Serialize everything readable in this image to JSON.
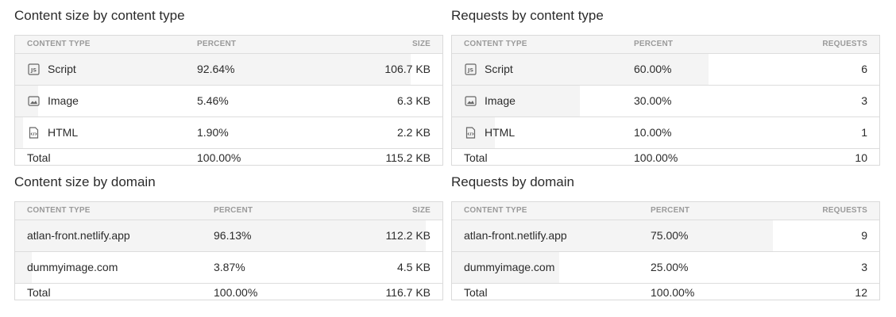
{
  "panels": {
    "size_type": {
      "title": "Content size by content type",
      "columns": [
        "CONTENT TYPE",
        "PERCENT",
        "SIZE"
      ],
      "rows": [
        {
          "icon": "js-file-icon",
          "name": "Script",
          "percent": "92.64%",
          "value": "106.7 KB",
          "share": 0.9264
        },
        {
          "icon": "image-file-icon",
          "name": "Image",
          "percent": "5.46%",
          "value": "6.3 KB",
          "share": 0.0546
        },
        {
          "icon": "html-file-icon",
          "name": "HTML",
          "percent": "1.90%",
          "value": "2.2 KB",
          "share": 0.019
        }
      ],
      "total": {
        "label": "Total",
        "percent": "100.00%",
        "value": "115.2 KB"
      }
    },
    "requests_type": {
      "title": "Requests by content type",
      "columns": [
        "CONTENT TYPE",
        "PERCENT",
        "REQUESTS"
      ],
      "rows": [
        {
          "icon": "js-file-icon",
          "name": "Script",
          "percent": "60.00%",
          "value": "6",
          "share": 0.6
        },
        {
          "icon": "image-file-icon",
          "name": "Image",
          "percent": "30.00%",
          "value": "3",
          "share": 0.3
        },
        {
          "icon": "html-file-icon",
          "name": "HTML",
          "percent": "10.00%",
          "value": "1",
          "share": 0.1
        }
      ],
      "total": {
        "label": "Total",
        "percent": "100.00%",
        "value": "10"
      }
    },
    "size_domain": {
      "title": "Content size by domain",
      "columns": [
        "CONTENT TYPE",
        "PERCENT",
        "SIZE"
      ],
      "rows": [
        {
          "name": "atlan-front.netlify.app",
          "percent": "96.13%",
          "value": "112.2 KB",
          "share": 0.9613
        },
        {
          "name": "dummyimage.com",
          "percent": "3.87%",
          "value": "4.5 KB",
          "share": 0.0387
        }
      ],
      "total": {
        "label": "Total",
        "percent": "100.00%",
        "value": "116.7 KB"
      }
    },
    "requests_domain": {
      "title": "Requests by domain",
      "columns": [
        "CONTENT TYPE",
        "PERCENT",
        "REQUESTS"
      ],
      "rows": [
        {
          "name": "atlan-front.netlify.app",
          "percent": "75.00%",
          "value": "9",
          "share": 0.75
        },
        {
          "name": "dummyimage.com",
          "percent": "25.00%",
          "value": "3",
          "share": 0.25
        }
      ],
      "total": {
        "label": "Total",
        "percent": "100.00%",
        "value": "12"
      }
    }
  }
}
